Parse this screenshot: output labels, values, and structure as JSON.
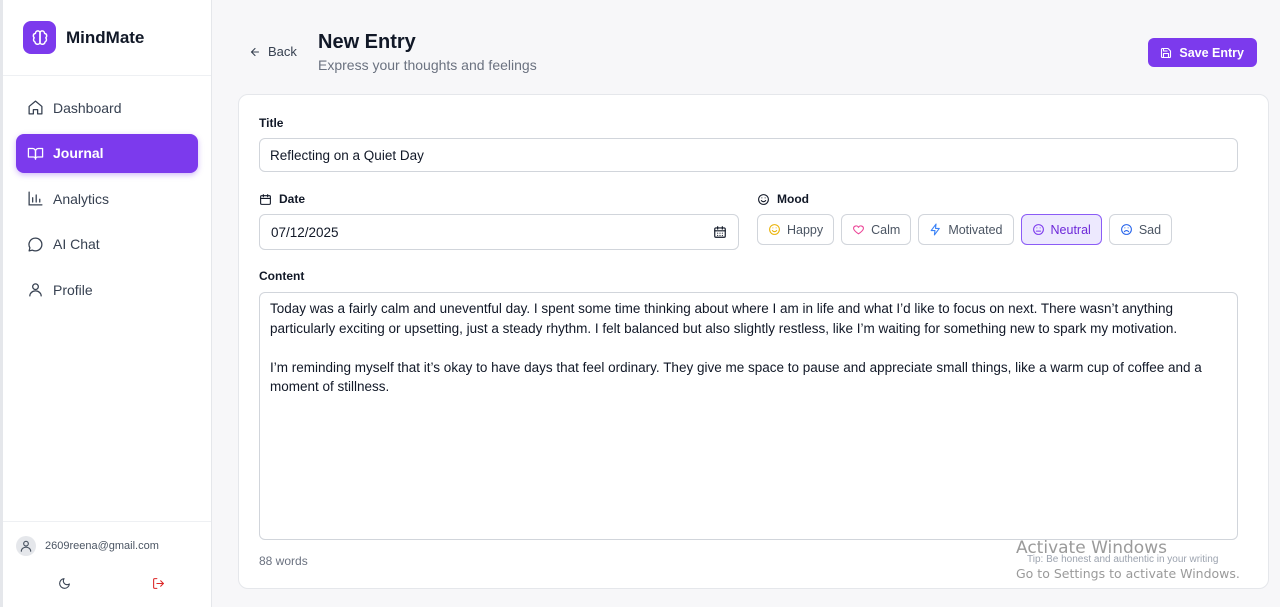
{
  "app": {
    "name": "MindMate"
  },
  "sidebar": {
    "items": [
      {
        "label": "Dashboard",
        "icon": "home-icon",
        "active": false
      },
      {
        "label": "Journal",
        "icon": "book-icon",
        "active": true
      },
      {
        "label": "Analytics",
        "icon": "bar-chart-icon",
        "active": false
      },
      {
        "label": "AI Chat",
        "icon": "chat-icon",
        "active": false
      },
      {
        "label": "Profile",
        "icon": "user-icon",
        "active": false
      }
    ],
    "user_email": "2609reena@gmail.com"
  },
  "header": {
    "back_label": "Back",
    "title": "New Entry",
    "subtitle": "Express your thoughts and feelings",
    "save_label": "Save Entry"
  },
  "form": {
    "title_label": "Title",
    "title_value": "Reflecting on a Quiet Day",
    "date_label": "Date",
    "date_value": "07/12/2025",
    "mood_label": "Mood",
    "moods": [
      {
        "label": "Happy",
        "icon": "smile-icon"
      },
      {
        "label": "Calm",
        "icon": "heart-icon"
      },
      {
        "label": "Motivated",
        "icon": "lightning-icon"
      },
      {
        "label": "Neutral",
        "icon": "neutral-face-icon"
      },
      {
        "label": "Sad",
        "icon": "sad-face-icon"
      }
    ],
    "selected_mood": "Neutral",
    "content_label": "Content",
    "content_paragraphs": [
      "Today was a fairly calm and uneventful day. I spent some time thinking about where I am in life and what I’d like to focus on next. There wasn’t anything particularly exciting or upsetting, just a steady rhythm. I felt balanced but also slightly restless, like I’m waiting for something new to spark my motivation.",
      "I’m reminding myself that it’s okay to have days that feel ordinary. They give me space to pause and appreciate small things, like a warm cup of coffee and a moment of stillness."
    ],
    "word_count": "88 words",
    "tip": "Tip: Be honest and authentic in your writing"
  },
  "watermark": {
    "title": "Activate Windows",
    "subtitle": "Go to Settings to activate Windows."
  },
  "colors": {
    "accent": "#7c3aed",
    "selected_bg": "#ede9fe"
  }
}
